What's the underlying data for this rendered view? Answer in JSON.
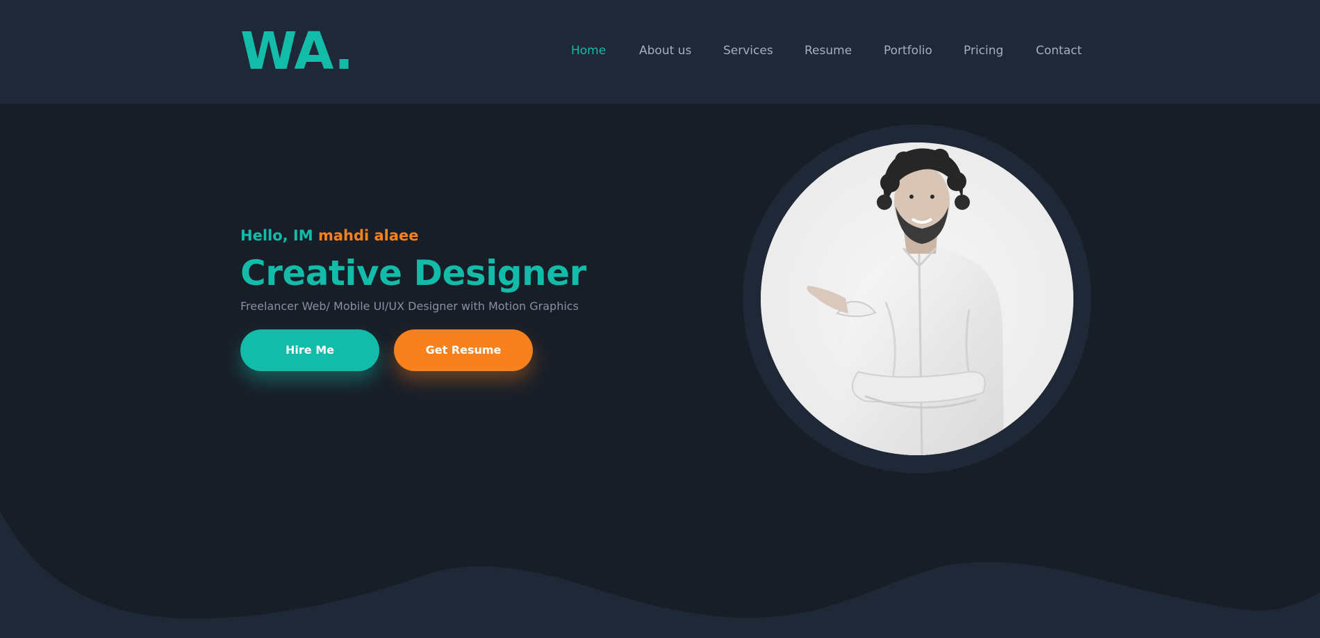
{
  "header": {
    "logo": "WA."
  },
  "nav": {
    "items": [
      {
        "label": "Home",
        "active": true
      },
      {
        "label": "About us",
        "active": false
      },
      {
        "label": "Services",
        "active": false
      },
      {
        "label": "Resume",
        "active": false
      },
      {
        "label": "Portfolio",
        "active": false
      },
      {
        "label": "Pricing",
        "active": false
      },
      {
        "label": "Contact",
        "active": false
      }
    ]
  },
  "hero": {
    "greeting_prefix": "Hello, IM",
    "greeting_name": "mahdi alaee",
    "title": "Creative Designer",
    "subtitle": "Freelancer Web/ Mobile UI/UX Designer with Motion Graphics",
    "hire_button": "Hire Me",
    "resume_button": "Get Resume"
  },
  "colors": {
    "accent": "#13bba9",
    "secondary": "#f7811c",
    "background": "#181e28",
    "header_bg": "#1f2836",
    "nav_text": "#a3b0c4",
    "muted_text": "#8691a3"
  }
}
